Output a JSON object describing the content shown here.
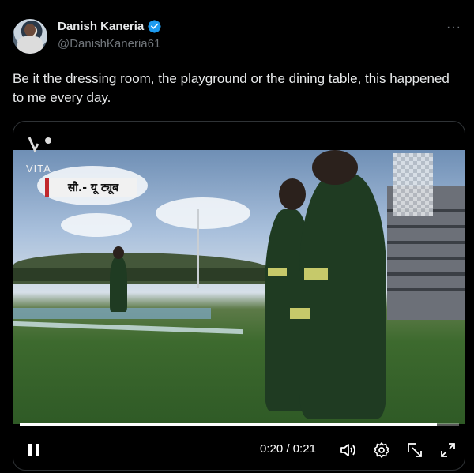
{
  "tweet": {
    "display_name": "Danish Kaneria",
    "handle": "@DanishKaneria61",
    "verified": true,
    "more_label": "···",
    "text": "Be it the dressing room, the playground or the dining table, this happened to me every day."
  },
  "video": {
    "watermark": "VITA",
    "hindi_caption": "सौ.- यू ट्यूब",
    "current_time": "0:20",
    "duration": "0:21",
    "time_separator": " / ",
    "progress_fraction": 0.95,
    "state": "playing"
  },
  "icons": {
    "pause": "pause-icon",
    "volume": "volume-icon",
    "settings": "gear-icon",
    "pip": "picture-in-picture-icon",
    "fullscreen": "fullscreen-icon"
  },
  "colors": {
    "background": "#000000",
    "text_primary": "#e7e9ea",
    "text_secondary": "#71767b",
    "verified": "#1d9bf0"
  }
}
